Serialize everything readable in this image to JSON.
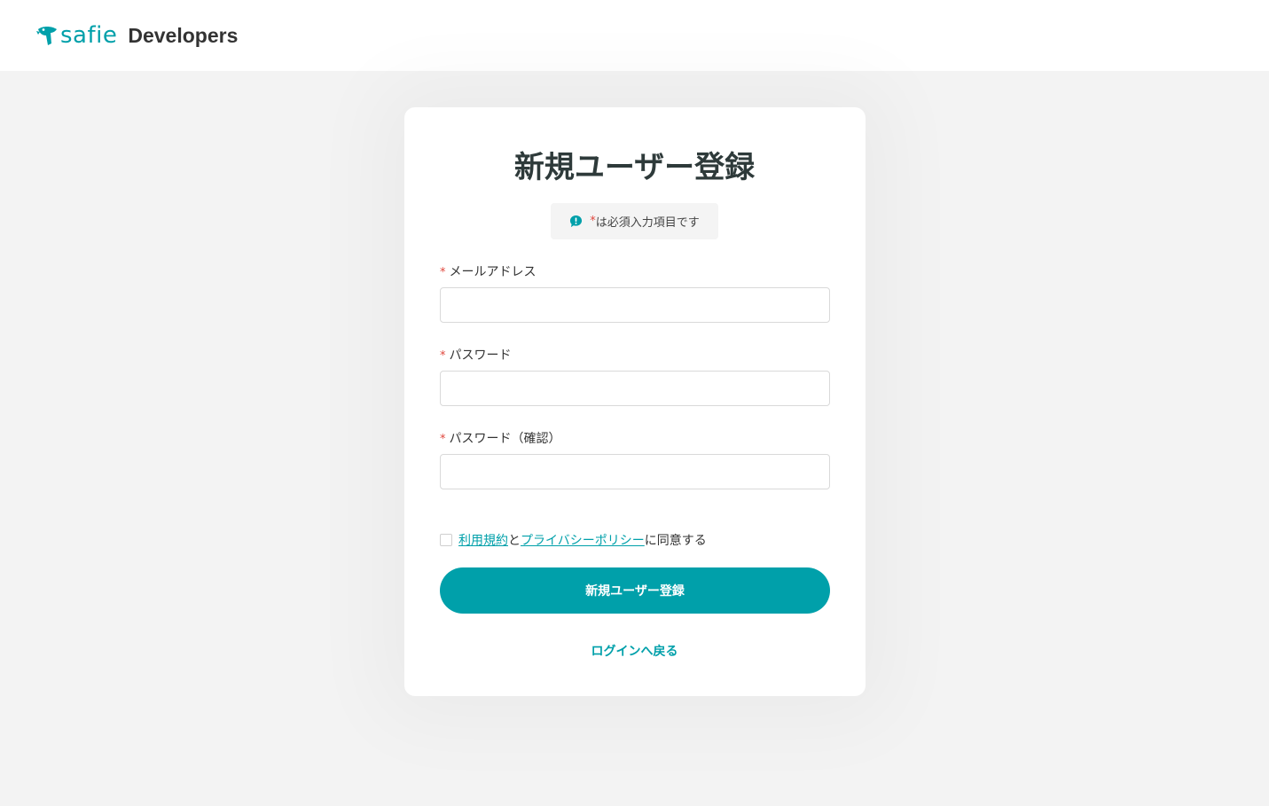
{
  "header": {
    "logo_icon": "safie-bird-logo-icon",
    "logo_text": "safie",
    "product_text": "Developers"
  },
  "form": {
    "title": "新規ユーザー登録",
    "required_notice_icon": "exclamation-speech-bubble-icon",
    "required_notice_asterisk": "*",
    "required_notice_text": "は必須入力項目です",
    "fields": [
      {
        "asterisk": "*",
        "label": "メールアドレス",
        "value": "",
        "placeholder": ""
      },
      {
        "asterisk": "*",
        "label": "パスワード",
        "value": "",
        "placeholder": ""
      },
      {
        "asterisk": "*",
        "label": "パスワード（確認）",
        "value": "",
        "placeholder": ""
      }
    ],
    "agreement": {
      "checked": false,
      "terms_link": "利用規約",
      "connector": "と",
      "privacy_link": "プライバシーポリシー",
      "suffix": "に同意する"
    },
    "submit_label": "新規ユーザー登録",
    "back_link": "ログインへ戻る"
  },
  "colors": {
    "accent": "#00a0aa",
    "required": "#e0483e",
    "background": "#f3f3f3",
    "title": "#2e3a3a"
  }
}
